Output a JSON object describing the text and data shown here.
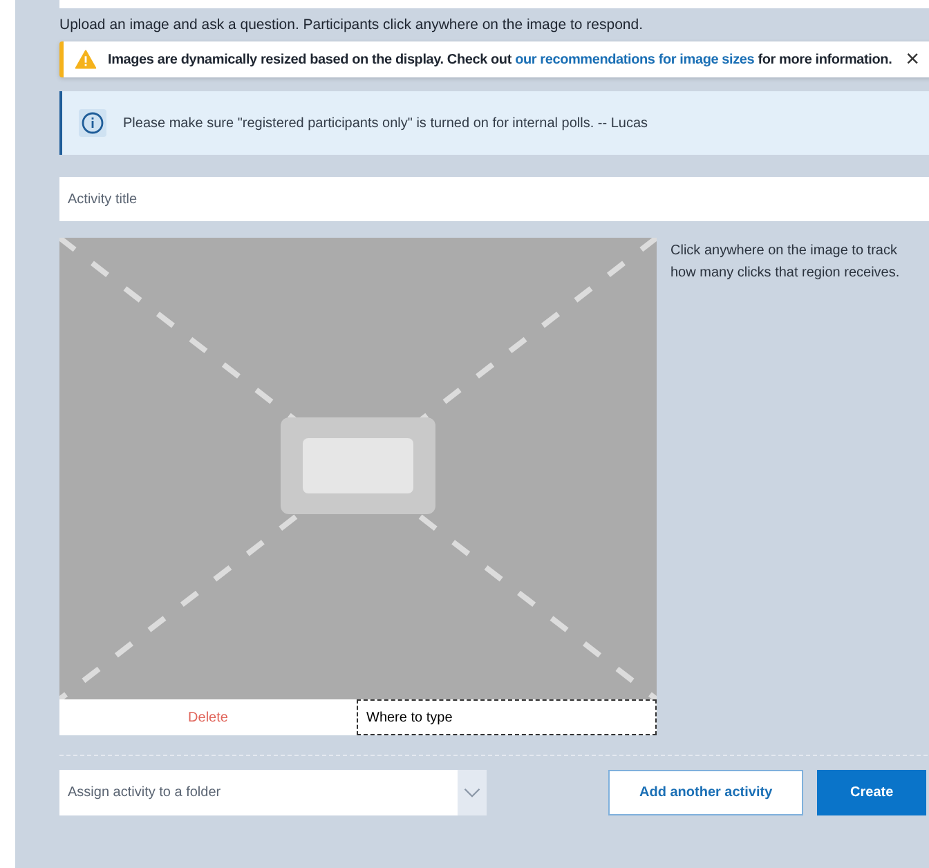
{
  "intro": "Upload an image and ask a question. Participants click anywhere on the image to respond.",
  "warning": {
    "text": "**Images are dynamically resized based on the display. Check out** ",
    "link": "our recommendations for image sizes",
    "after": "for more information.",
    "close": "×"
  },
  "info": {
    "text": "Please make sure \"registered participants only\" is turned on for internal polls. -- Lucas"
  },
  "title_field": {
    "placeholder": "Activity title"
  },
  "hint": "Click anywhere on the image to track how many clicks that region receives.",
  "image_actions": {
    "delete": "Delete",
    "answer_value": "Where to type"
  },
  "folder_select": {
    "placeholder": "Assign activity to a folder"
  },
  "buttons": [
    {
      "label": "Add another activity",
      "kind": "secondary"
    },
    {
      "label": "Create",
      "kind": "primary"
    }
  ]
}
